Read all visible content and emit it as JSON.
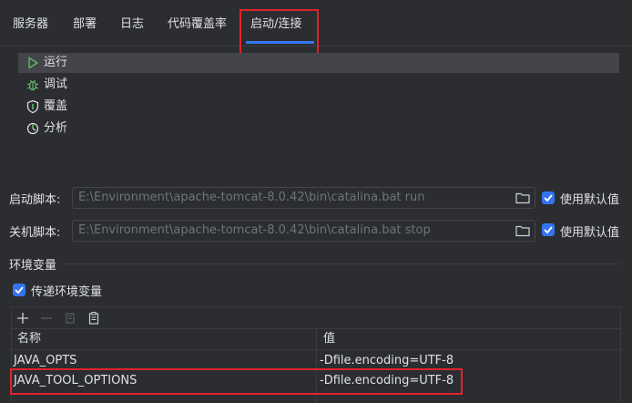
{
  "tabs": [
    {
      "label": "服务器"
    },
    {
      "label": "部署"
    },
    {
      "label": "日志"
    },
    {
      "label": "代码覆盖率"
    },
    {
      "label": "启动/连接",
      "active": true
    }
  ],
  "modes": [
    {
      "label": "运行",
      "icon": "run-icon",
      "selected": true
    },
    {
      "label": "调试",
      "icon": "debug-icon"
    },
    {
      "label": "覆盖",
      "icon": "coverage-icon"
    },
    {
      "label": "分析",
      "icon": "profiler-icon"
    }
  ],
  "startup_script": {
    "label": "启动脚本:",
    "value": "E:\\Environment\\apache-tomcat-8.0.42\\bin\\catalina.bat run",
    "use_default_label": "使用默认值",
    "use_default_checked": true
  },
  "shutdown_script": {
    "label": "关机脚本:",
    "value": "E:\\Environment\\apache-tomcat-8.0.42\\bin\\catalina.bat stop",
    "use_default_label": "使用默认值",
    "use_default_checked": true
  },
  "env": {
    "section_title": "环境变量",
    "pass_env_label": "传递环境变量",
    "pass_env_checked": true,
    "columns": {
      "name": "名称",
      "value": "值"
    },
    "rows": [
      {
        "name": "JAVA_OPTS",
        "value": "-Dfile.encoding=UTF-8"
      },
      {
        "name": "JAVA_TOOL_OPTIONS",
        "value": "-Dfile.encoding=UTF-8"
      }
    ]
  },
  "colors": {
    "accent": "#3574f0",
    "highlight": "#e0242a",
    "background": "#2b2d30"
  }
}
